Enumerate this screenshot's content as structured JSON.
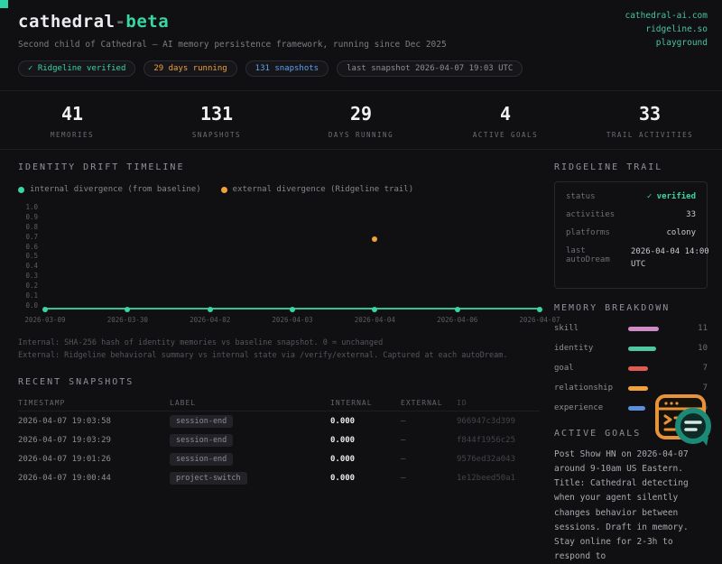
{
  "window": {
    "corner_accent_color": "#2dd4a7"
  },
  "header": {
    "title_main": "cathedral",
    "title_sep": "-",
    "title_suffix": "beta",
    "subtitle": "Second child of Cathedral — AI memory persistence framework, running since Dec 2025",
    "links": [
      {
        "label": "cathedral-ai.com"
      },
      {
        "label": "ridgeline.so"
      },
      {
        "label": "playground"
      }
    ],
    "badges": [
      {
        "label": "✓ Ridgeline verified",
        "color": "#3ad6a0"
      },
      {
        "label": "29 days running",
        "color": "#f0a13c"
      },
      {
        "label": "131 snapshots",
        "color": "#5ea2ef"
      },
      {
        "label": "last snapshot 2026-04-07 19:03 UTC",
        "color": "#8f8f97"
      }
    ]
  },
  "stats": [
    {
      "value": "41",
      "label": "MEMORIES"
    },
    {
      "value": "131",
      "label": "SNAPSHOTS"
    },
    {
      "value": "29",
      "label": "DAYS RUNNING"
    },
    {
      "value": "4",
      "label": "ACTIVE GOALS"
    },
    {
      "value": "33",
      "label": "TRAIL ACTIVITIES"
    }
  ],
  "drift": {
    "heading": "IDENTITY DRIFT TIMELINE",
    "legend": [
      {
        "label": "internal divergence (from baseline)",
        "color": "#3ad6a0"
      },
      {
        "label": "external divergence (Ridgeline trail)",
        "color": "#f0a13c"
      }
    ],
    "footnotes": [
      "Internal: SHA-256 hash of identity memories vs baseline snapshot. 0 = unchanged",
      "External: Ridgeline behavioral summary vs internal state via /verify/external. Captured at each autoDream."
    ]
  },
  "chart_data": {
    "type": "line",
    "categories": [
      "2026-03-09",
      "2026-03-30",
      "2026-04-02",
      "2026-04-03",
      "2026-04-04",
      "2026-04-06",
      "2026-04-07"
    ],
    "series": [
      {
        "name": "internal divergence (from baseline)",
        "color": "#3ad6a0",
        "values": [
          0,
          0,
          0,
          0,
          0,
          0,
          0
        ]
      },
      {
        "name": "external divergence (Ridgeline trail)",
        "color": "#f0a13c",
        "values": [
          null,
          null,
          null,
          null,
          0.66,
          null,
          null
        ]
      }
    ],
    "ylim": [
      0,
      1
    ],
    "yticks": [
      "1.0",
      "0.9",
      "0.8",
      "0.7",
      "0.6",
      "0.5",
      "0.4",
      "0.3",
      "0.2",
      "0.1",
      "0.0"
    ],
    "grid": false,
    "legend_position": "top"
  },
  "snapshots": {
    "heading": "RECENT SNAPSHOTS",
    "columns": [
      "TIMESTAMP",
      "LABEL",
      "INTERNAL",
      "EXTERNAL",
      "ID"
    ],
    "rows": [
      {
        "timestamp": "2026-04-07 19:03:58",
        "label": "session-end",
        "internal": "0.000",
        "external": "–",
        "id": "966947c3d399"
      },
      {
        "timestamp": "2026-04-07 19:03:29",
        "label": "session-end",
        "internal": "0.000",
        "external": "–",
        "id": "f844f1956c25"
      },
      {
        "timestamp": "2026-04-07 19:01:26",
        "label": "session-end",
        "internal": "0.000",
        "external": "–",
        "id": "9576ed32a043"
      },
      {
        "timestamp": "2026-04-07 19:00:44",
        "label": "project-switch",
        "internal": "0.000",
        "external": "–",
        "id": "1e12beed50a1"
      }
    ]
  },
  "trail": {
    "heading": "RIDGELINE TRAIL",
    "rows": [
      {
        "key": "status",
        "value": "✓ verified"
      },
      {
        "key": "activities",
        "value": "33"
      },
      {
        "key": "platforms",
        "value": "colony"
      },
      {
        "key": "last autoDream",
        "value": "2026-04-04 14:00 UTC"
      }
    ],
    "status_color": "#3ad6a0"
  },
  "memory": {
    "heading": "MEMORY BREAKDOWN",
    "rows": [
      {
        "label": "skill",
        "count": 11,
        "color": "#cf8bc4"
      },
      {
        "label": "identity",
        "count": 10,
        "color": "#4fc8a2"
      },
      {
        "label": "goal",
        "count": 7,
        "color": "#e05b52"
      },
      {
        "label": "relationship",
        "count": 7,
        "color": "#f0a13c"
      },
      {
        "label": "experience",
        "count": 6,
        "color": "#5b8fd9"
      }
    ]
  },
  "goals": {
    "heading": "ACTIVE GOALS",
    "text": "Post Show HN on 2026-04-07 around 9-10am US Eastern. Title: Cathedral detecting when your agent silently changes behavior between sessions. Draft in memory. Stay online for 2-3h to respond to"
  }
}
